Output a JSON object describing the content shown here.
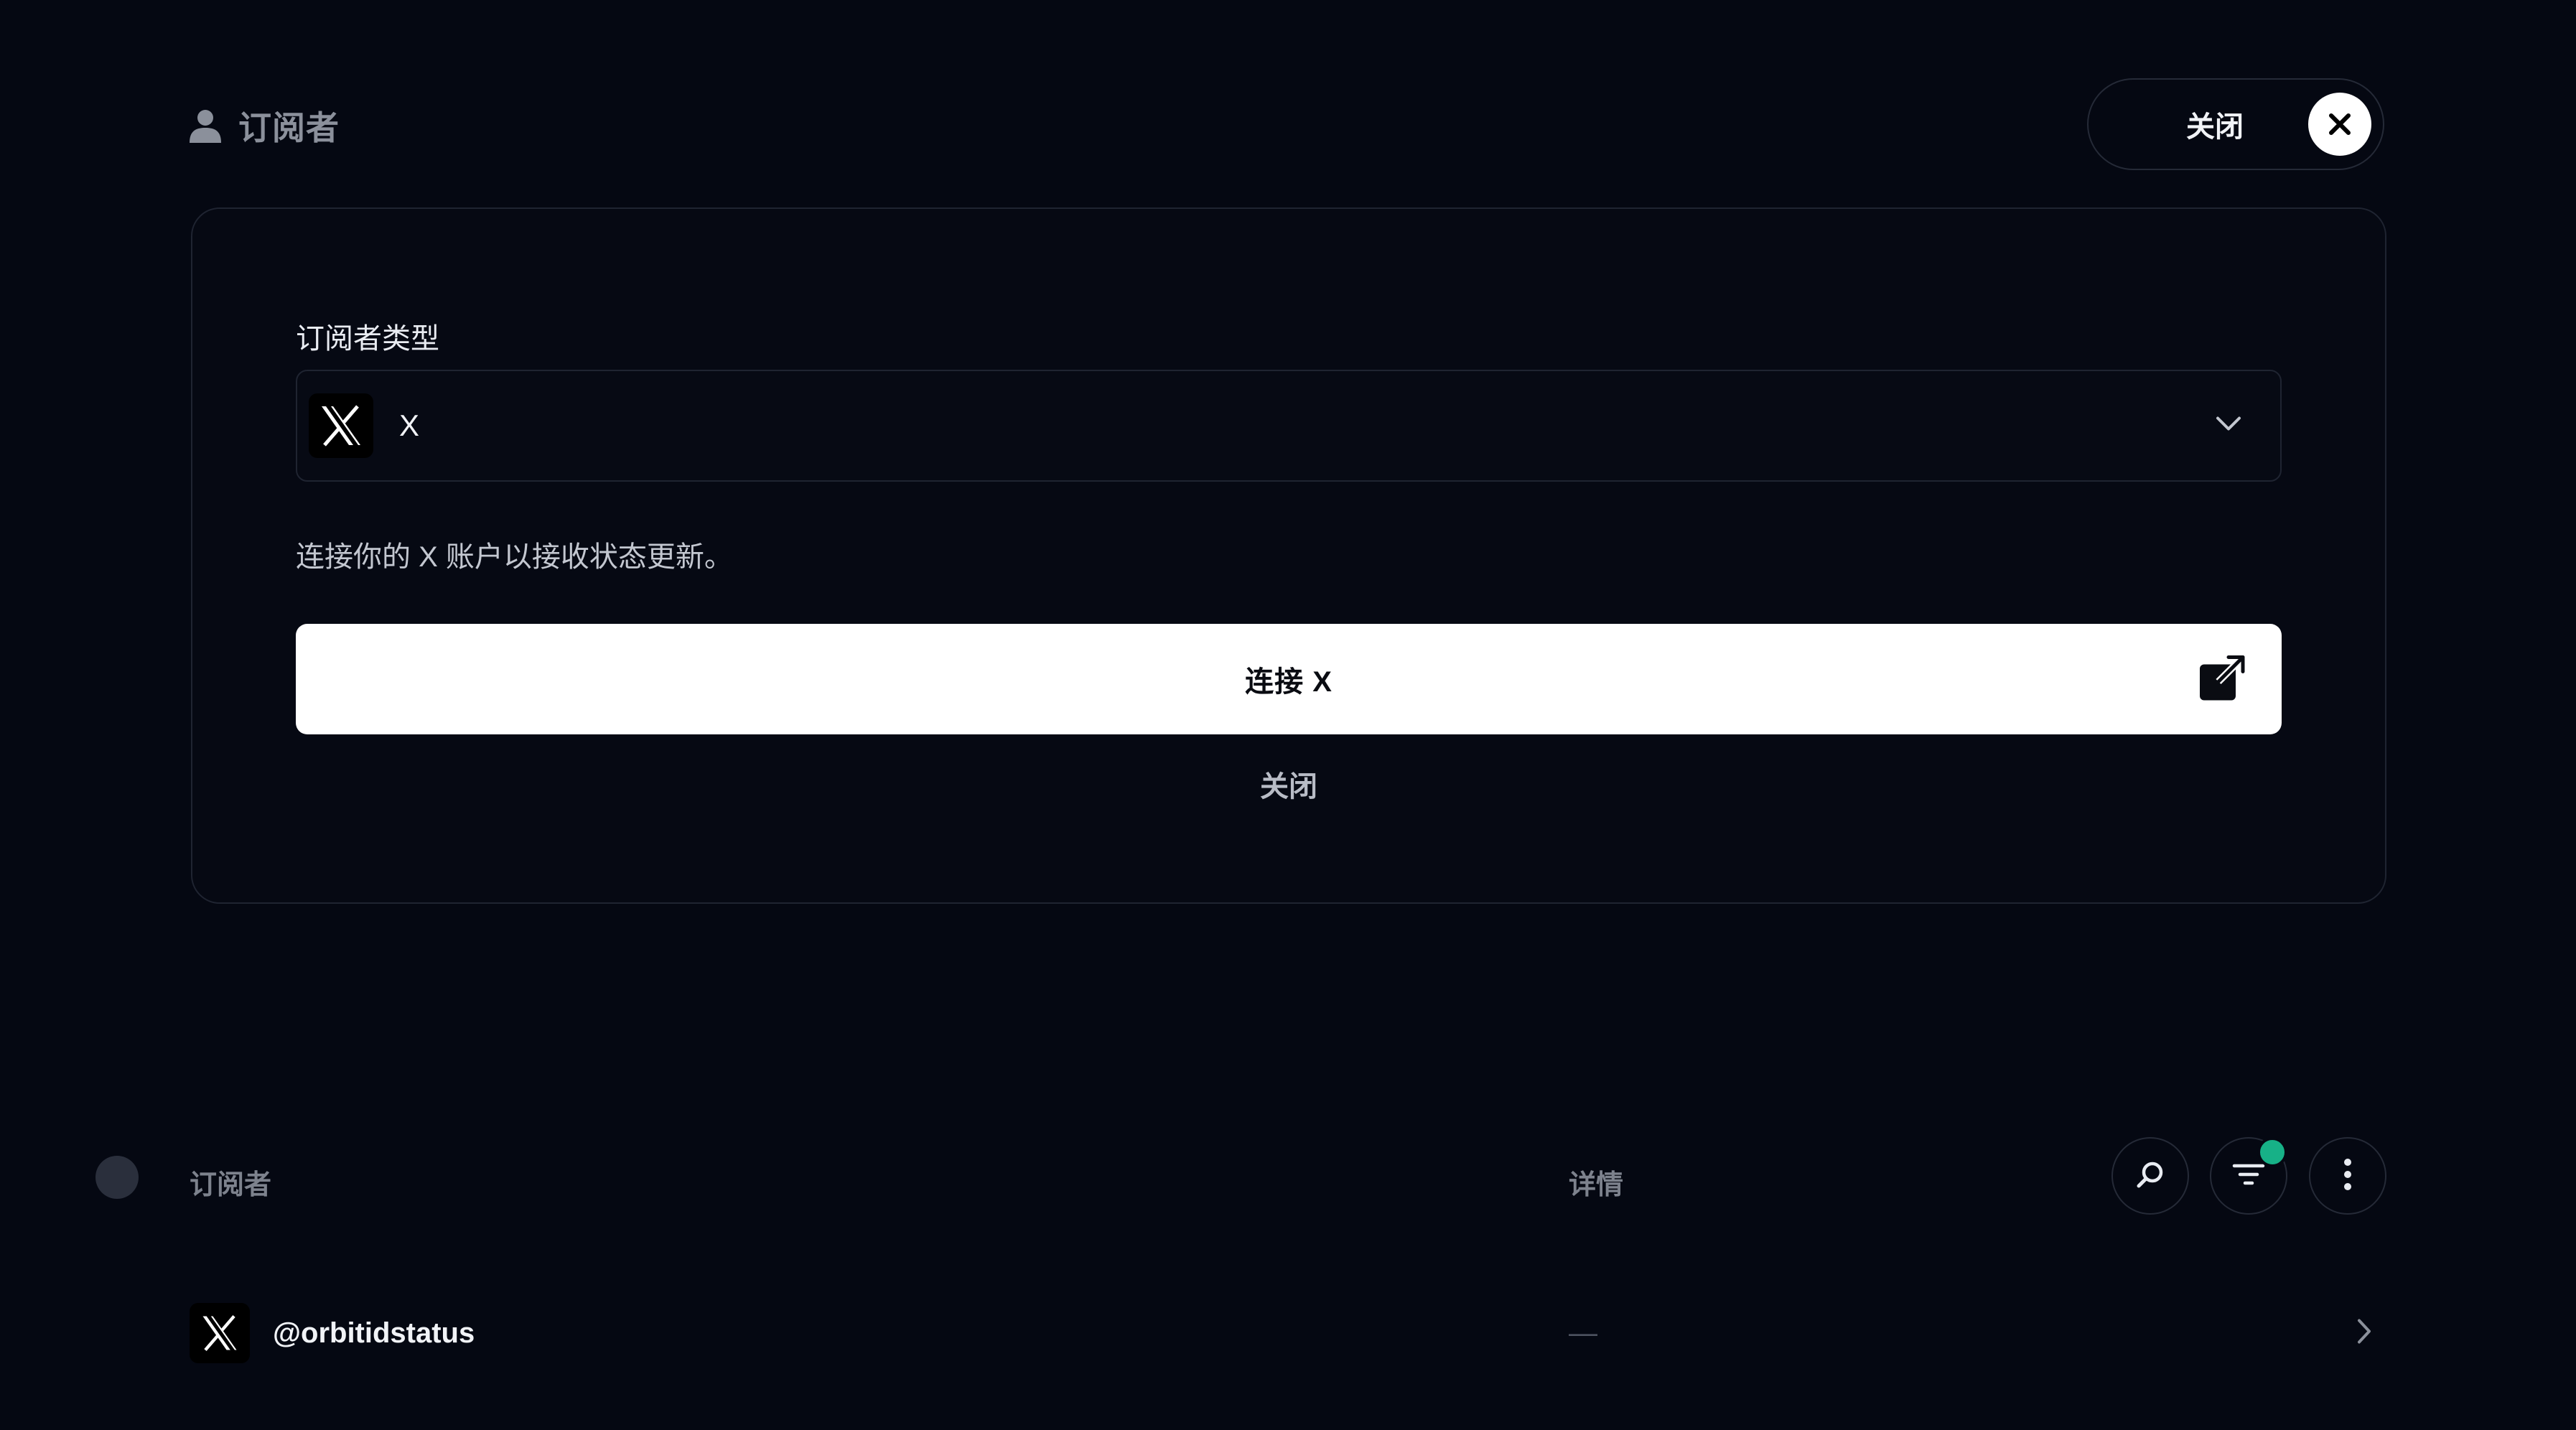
{
  "header": {
    "title": "订阅者",
    "close_label": "关闭"
  },
  "form": {
    "field_label": "订阅者类型",
    "selected_type": "X",
    "help_text": "连接你的 X 账户以接收状态更新。",
    "connect_label": "连接 X",
    "close_label": "关闭"
  },
  "list": {
    "col_subscriber": "订阅者",
    "col_details": "详情",
    "filter_active_color": "#17b187",
    "rows": [
      {
        "handle": "@orbitidstatus",
        "details": "—"
      }
    ]
  },
  "icons": {
    "header": "user-icon",
    "close": "close-icon",
    "type": "x-logo-icon",
    "dropdown": "chevron-down-icon",
    "external": "external-link-icon",
    "search": "search-icon",
    "filter": "filter-icon",
    "more": "more-vertical-icon",
    "row_arrow": "chevron-right-icon"
  }
}
